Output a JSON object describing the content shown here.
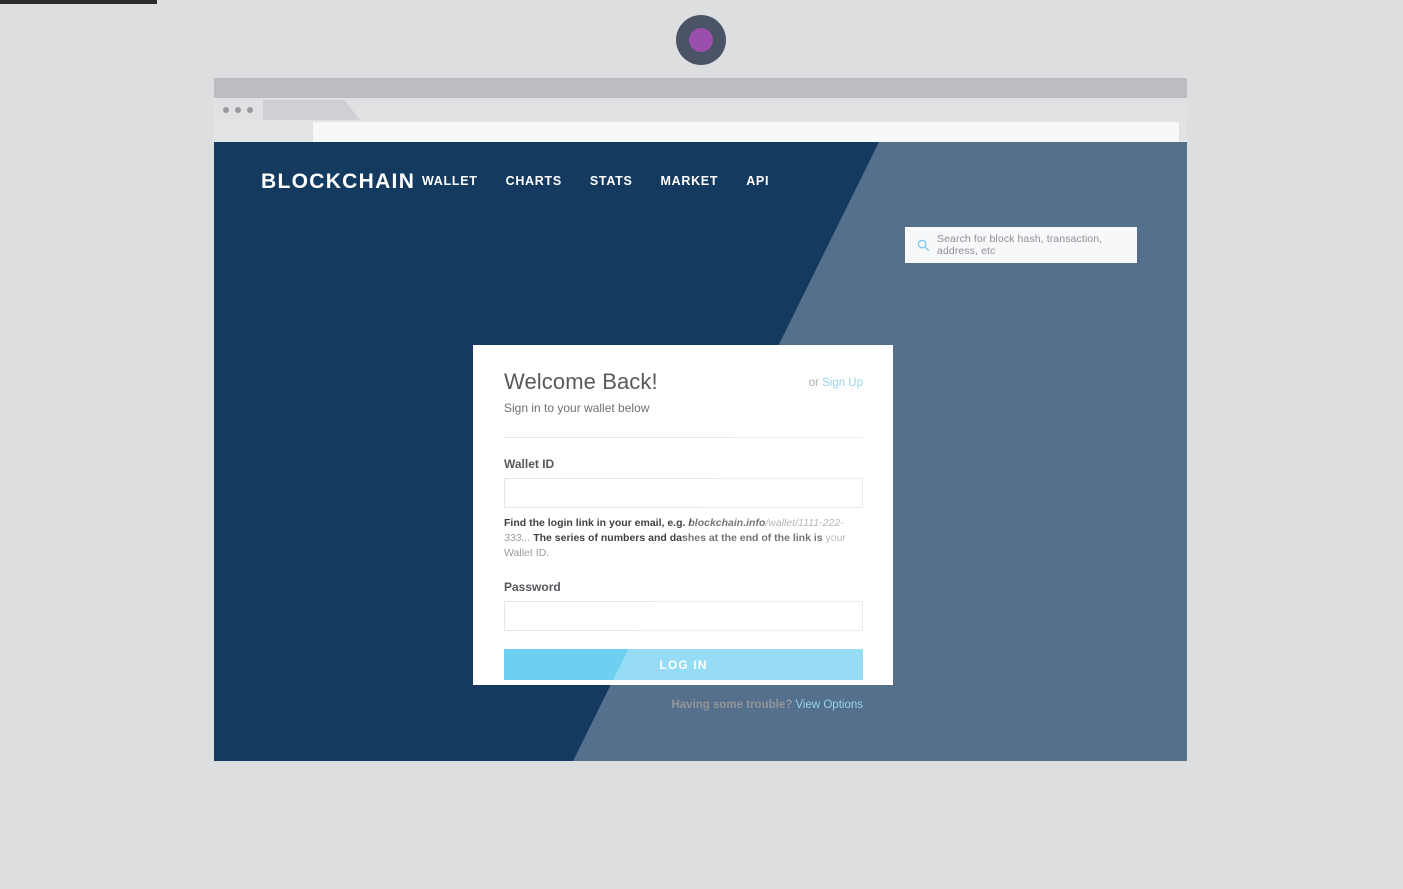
{
  "browser": {
    "tab_title": "",
    "url_value": ""
  },
  "site": {
    "brand": "BLOCKCHAIN",
    "nav": [
      {
        "label": "WALLET"
      },
      {
        "label": "CHARTS"
      },
      {
        "label": "STATS"
      },
      {
        "label": "MARKET"
      },
      {
        "label": "API"
      }
    ],
    "search": {
      "placeholder": "Search for block hash, transaction, address, etc",
      "value": "",
      "icon": "search-icon"
    },
    "colors": {
      "header_navy": "#143a60",
      "accent_blue": "#6ecff0",
      "link_blue": "#6ec3e8",
      "glare": "rgba(255,255,255,0.28)",
      "camera_lens": "#9b4fad"
    }
  },
  "login_card": {
    "heading": "Welcome Back!",
    "subtitle": "Sign in to your wallet below",
    "or_text": "or",
    "signup_link": "Sign Up",
    "wallet_id": {
      "label": "Wallet ID",
      "value": "",
      "placeholder": ""
    },
    "helper": {
      "part1": "Find the login link in your email, e.g. ",
      "domain": "blockchain.info",
      "path": "/wallet/1111-222-333...",
      "part2": " The series of numbers and dashes at the end of the link is ",
      "part3": "your Wallet ID."
    },
    "password": {
      "label": "Password",
      "value": "",
      "placeholder": ""
    },
    "submit_label": "LOG IN",
    "trouble_text": "Having some trouble?",
    "trouble_link": "View Options"
  }
}
